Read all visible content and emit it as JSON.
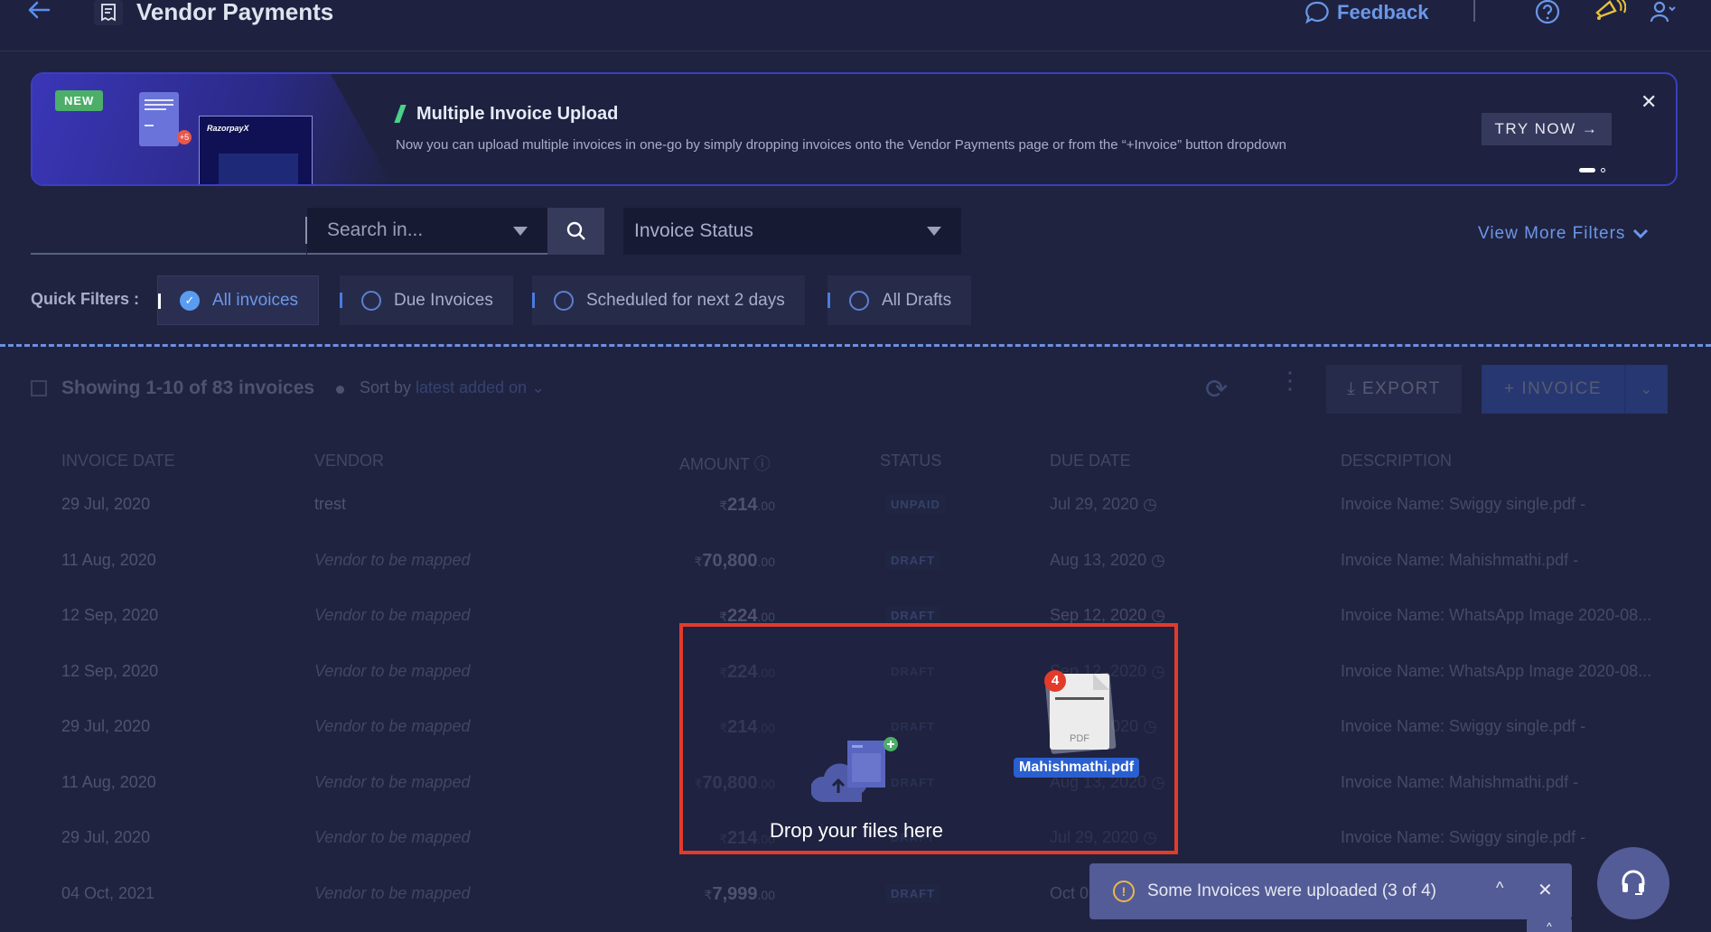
{
  "header": {
    "title": "Vendor Payments",
    "feedback_label": "Feedback",
    "icons": {
      "back": "arrow-left-icon",
      "page": "receipt-icon",
      "feedback": "chat-bubble-icon",
      "help": "question-circle-icon",
      "announcements": "megaphone-icon",
      "user": "user-menu-icon"
    }
  },
  "banner": {
    "badge": "NEW",
    "art_logo": "RazorpayX",
    "art_count": "+5",
    "title": "Multiple Invoice Upload",
    "description": "Now you can upload multiple invoices in one-go by simply dropping invoices onto the Vendor Payments page or from the “+Invoice” button dropdown",
    "cta_label": "TRY NOW →",
    "close_label": "✕",
    "pagination": {
      "current": 1,
      "total": 2
    }
  },
  "filters": {
    "search_value": "",
    "search_in_placeholder": "Search in...",
    "status_placeholder": "Invoice Status",
    "view_more_label": "View More Filters",
    "quick_filters_label": "Quick Filters :",
    "quick_filters": [
      {
        "label": "All invoices",
        "selected": true
      },
      {
        "label": "Due Invoices",
        "selected": false
      },
      {
        "label": "Scheduled for next 2 days",
        "selected": false
      },
      {
        "label": "All Drafts",
        "selected": false
      }
    ]
  },
  "table": {
    "showing_text": "Showing 1-10 of 83 invoices",
    "sort_prefix": "Sort by",
    "sort_value": "latest added on",
    "export_label": "EXPORT",
    "invoice_label": "+  INVOICE",
    "columns": [
      "INVOICE DATE",
      "VENDOR",
      "AMOUNT",
      "STATUS",
      "DUE DATE",
      "DESCRIPTION"
    ],
    "rows": [
      {
        "date": "29 Jul, 2020",
        "vendor": "trest",
        "vendor_mapped": true,
        "amount": "214",
        "decimals": ".00",
        "status": "UNPAID",
        "due": "Jul 29, 2020",
        "desc": "Invoice Name: Swiggy single.pdf -"
      },
      {
        "date": "11 Aug, 2020",
        "vendor": "Vendor to be mapped",
        "vendor_mapped": false,
        "amount": "70,800",
        "decimals": ".00",
        "status": "DRAFT",
        "due": "Aug 13, 2020",
        "desc": "Invoice Name: Mahishmathi.pdf -"
      },
      {
        "date": "12 Sep, 2020",
        "vendor": "Vendor to be mapped",
        "vendor_mapped": false,
        "amount": "224",
        "decimals": ".00",
        "status": "DRAFT",
        "due": "Sep 12, 2020",
        "desc": "Invoice Name: WhatsApp Image 2020-08..."
      },
      {
        "date": "12 Sep, 2020",
        "vendor": "Vendor to be mapped",
        "vendor_mapped": false,
        "amount": "224",
        "decimals": ".00",
        "status": "DRAFT",
        "due": "Sep 12, 2020",
        "desc": "Invoice Name: WhatsApp Image 2020-08..."
      },
      {
        "date": "29 Jul, 2020",
        "vendor": "Vendor to be mapped",
        "vendor_mapped": false,
        "amount": "214",
        "decimals": ".00",
        "status": "DRAFT",
        "due": "Jul 29, 2020",
        "desc": "Invoice Name: Swiggy single.pdf -"
      },
      {
        "date": "11 Aug, 2020",
        "vendor": "Vendor to be mapped",
        "vendor_mapped": false,
        "amount": "70,800",
        "decimals": ".00",
        "status": "DRAFT",
        "due": "Aug 13, 2020",
        "desc": "Invoice Name: Mahishmathi.pdf -"
      },
      {
        "date": "29 Jul, 2020",
        "vendor": "Vendor to be mapped",
        "vendor_mapped": false,
        "amount": "214",
        "decimals": ".00",
        "status": "DRAFT",
        "due": "Jul 29, 2020",
        "desc": "Invoice Name: Swiggy single.pdf -"
      },
      {
        "date": "04 Oct, 2021",
        "vendor": "Vendor to be mapped",
        "vendor_mapped": false,
        "amount": "7,999",
        "decimals": ".00",
        "status": "DRAFT",
        "due": "Oct 0",
        "desc": ""
      }
    ],
    "currency_symbol": "₹"
  },
  "drop_zone": {
    "text": "Drop your files here",
    "dragged_file_name": "Mahishmathi.pdf",
    "dragged_file_type": "PDF",
    "dragged_count": "4"
  },
  "toast": {
    "message": "Some Invoices were uploaded (3 of 4)",
    "expand_label": "^",
    "close_label": "✕",
    "tab_label": "^"
  },
  "colors": {
    "background": "#1f2340",
    "accent": "#6b97e8",
    "primary_button": "#3a6cf0",
    "drop_border": "#e23b2a",
    "new_badge": "#4cae69",
    "warning": "#e9b949",
    "toast_bg": "#535c96"
  }
}
